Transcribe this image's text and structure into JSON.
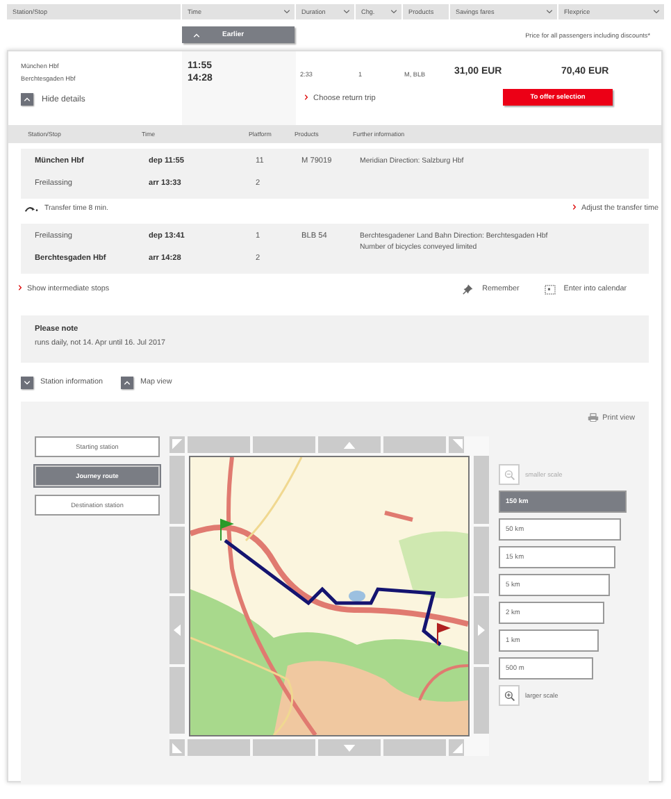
{
  "header_columns": [
    {
      "label": "Station/Stop",
      "sortable": false
    },
    {
      "label": "Time",
      "sortable": true
    },
    {
      "label": "Duration",
      "sortable": true
    },
    {
      "label": "Chg.",
      "sortable": true
    },
    {
      "label": "Products",
      "sortable": false
    },
    {
      "label": "Savings fares",
      "sortable": true
    },
    {
      "label": "Flexprice",
      "sortable": true
    }
  ],
  "earlier_button": "Earlier",
  "price_note": "Price for all passengers including discounts*",
  "connection": {
    "from": "München Hbf",
    "to": "Berchtesgaden Hbf",
    "dep": "11:55",
    "arr": "14:28",
    "duration": "2:33",
    "changes": "1",
    "products": "M, BLB",
    "savings_price": "31,00 EUR",
    "flex_price": "70,40 EUR",
    "details_toggle": {
      "label": "Hide details",
      "expanded": true
    },
    "return_link": "Choose return trip",
    "offer_button": "To offer selection"
  },
  "details": {
    "columns": [
      "Station/Stop",
      "Time",
      "Platform",
      "Products",
      "Further information"
    ],
    "legs": [
      {
        "kind": "segment",
        "product": "M 79019",
        "info": [
          "Meridian Direction: Salzburg Hbf"
        ],
        "stops": [
          {
            "station": "München Hbf",
            "main": true,
            "time": "dep 11:55",
            "platform": "11"
          },
          {
            "station": "Freilassing",
            "main": false,
            "time": "arr 13:33",
            "platform": "2"
          }
        ]
      },
      {
        "kind": "transfer",
        "text": "Transfer time 8 min.",
        "link": "Adjust the transfer time"
      },
      {
        "kind": "segment",
        "product": "BLB 54",
        "info": [
          "Berchtesgadener Land Bahn Direction: Berchtesgaden Hbf",
          "Number of bicycles conveyed limited"
        ],
        "stops": [
          {
            "station": "Freilassing",
            "main": false,
            "time": "dep 13:41",
            "platform": "1"
          },
          {
            "station": "Berchtesgaden Hbf",
            "main": true,
            "time": "arr 14:28",
            "platform": "2"
          }
        ]
      }
    ]
  },
  "actions": {
    "intermediate": "Show intermediate stops",
    "remember": "Remember",
    "calendar": "Enter into calendar"
  },
  "note": {
    "title": "Please note",
    "text": "runs daily, not 14. Apr until 16. Jul 2017"
  },
  "toggles": [
    {
      "label": "Station information",
      "expanded": false
    },
    {
      "label": "Map view",
      "expanded": true
    }
  ],
  "map": {
    "print": "Print view",
    "views": [
      {
        "label": "Starting station",
        "selected": false
      },
      {
        "label": "Journey route",
        "selected": true
      },
      {
        "label": "Destination station",
        "selected": false
      }
    ],
    "smaller": "smaller scale",
    "larger": "larger scale",
    "scales": [
      {
        "label": "150 km",
        "selected": true
      },
      {
        "label": "50 km",
        "selected": false
      },
      {
        "label": "15 km",
        "selected": false
      },
      {
        "label": "5 km",
        "selected": false
      },
      {
        "label": "2 km",
        "selected": false
      },
      {
        "label": "1 km",
        "selected": false
      },
      {
        "label": "500 m",
        "selected": false
      }
    ]
  }
}
